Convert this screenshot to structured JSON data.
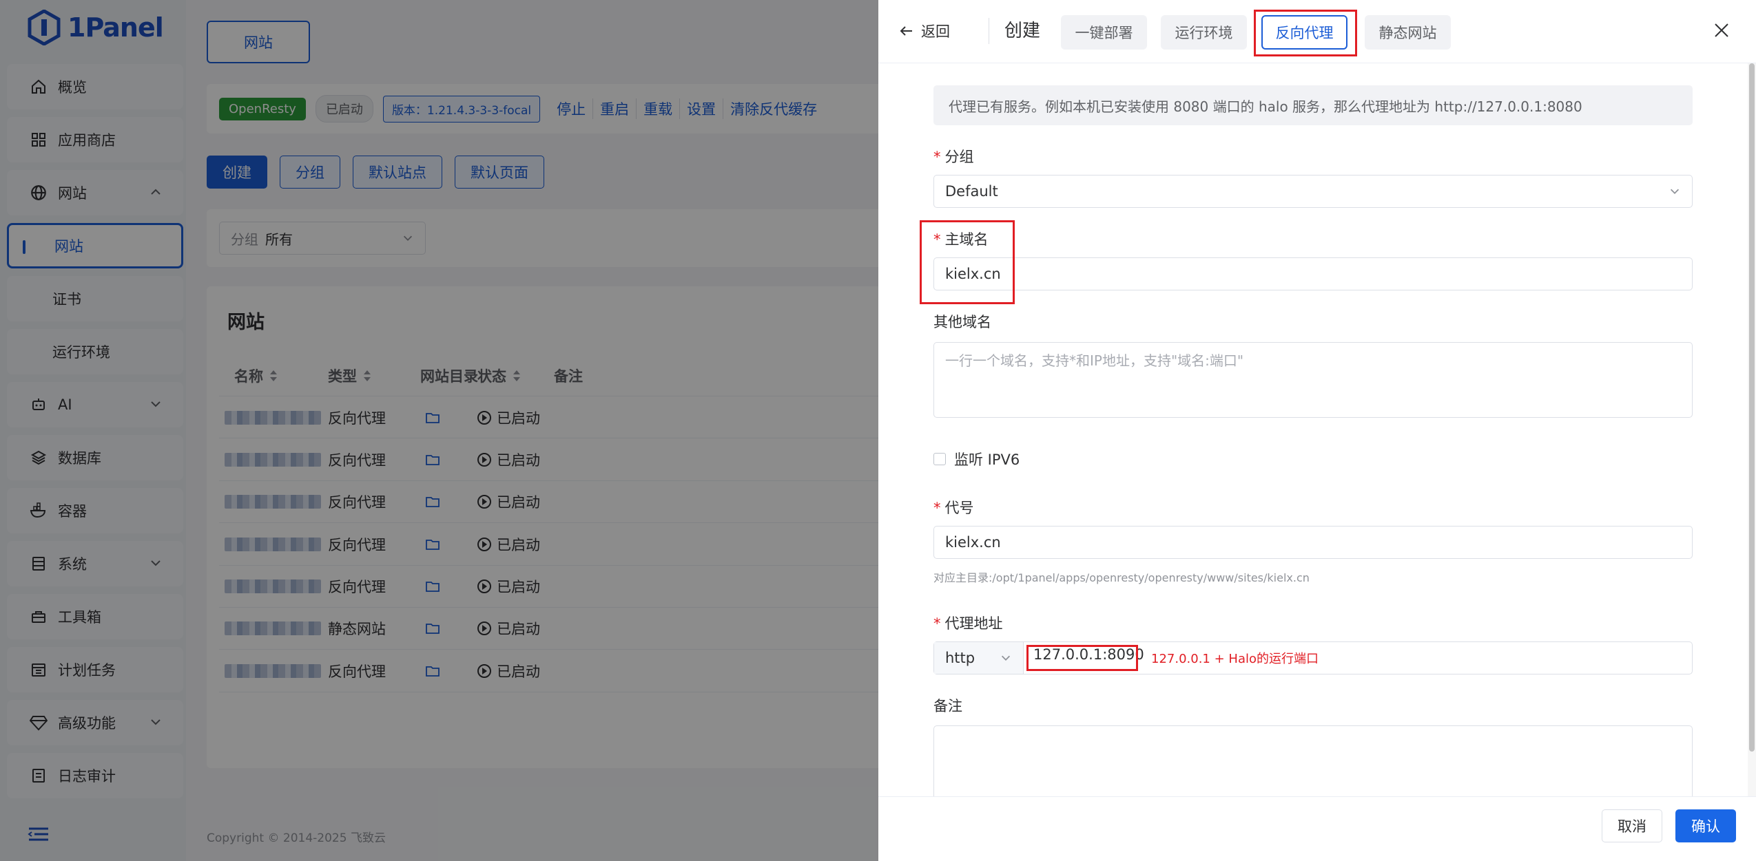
{
  "sidebar": {
    "logo_text": "1Panel",
    "items": [
      {
        "label": "概览",
        "icon": "home-icon"
      },
      {
        "label": "应用商店",
        "icon": "grid-icon"
      },
      {
        "label": "网站",
        "icon": "globe-icon"
      },
      {
        "label": "网站",
        "sub": true,
        "active": true
      },
      {
        "label": "证书",
        "sub": true
      },
      {
        "label": "运行环境",
        "sub": true
      },
      {
        "label": "AI",
        "icon": "robot-icon"
      },
      {
        "label": "数据库",
        "icon": "layers-icon"
      },
      {
        "label": "容器",
        "icon": "container-icon"
      },
      {
        "label": "系统",
        "icon": "server-icon"
      },
      {
        "label": "工具箱",
        "icon": "toolbox-icon"
      },
      {
        "label": "计划任务",
        "icon": "calendar-icon"
      },
      {
        "label": "高级功能",
        "icon": "diamond-icon"
      },
      {
        "label": "日志审计",
        "icon": "log-icon"
      }
    ]
  },
  "main": {
    "tab_label": "网站",
    "status": {
      "app": "OpenResty",
      "state": "已启动",
      "version": "版本：1.21.4.3-3-3-focal",
      "actions": [
        "停止",
        "重启",
        "重载",
        "设置",
        "清除反代缓存"
      ]
    },
    "buttons": {
      "create": "创建",
      "group": "分组",
      "default_site": "默认站点",
      "default_page": "默认页面"
    },
    "filter": {
      "label": "分组",
      "value": "所有"
    },
    "table": {
      "title": "网站",
      "columns": [
        "名称",
        "类型",
        "网站目录",
        "状态",
        "备注"
      ],
      "rows": [
        {
          "type": "反向代理",
          "status": "已启动"
        },
        {
          "type": "反向代理",
          "status": "已启动"
        },
        {
          "type": "反向代理",
          "status": "已启动"
        },
        {
          "type": "反向代理",
          "status": "已启动"
        },
        {
          "type": "反向代理",
          "status": "已启动"
        },
        {
          "type": "静态网站",
          "status": "已启动"
        },
        {
          "type": "反向代理",
          "status": "已启动"
        }
      ]
    },
    "footer": "Copyright © 2014-2025 飞致云"
  },
  "drawer": {
    "back_label": "返回",
    "title": "创建",
    "tabs": [
      "一键部署",
      "运行环境",
      "反向代理",
      "静态网站"
    ],
    "active_tab": "反向代理",
    "alert": "代理已有服务。例如本机已安装使用 8080 端口的 halo 服务，那么代理地址为 http://127.0.0.1:8080",
    "form": {
      "group_label": "分组",
      "group_value": "Default",
      "domain_label": "主域名",
      "domain_value": "kielx.cn",
      "other_domains_label": "其他域名",
      "other_domains_placeholder": "一行一个域名，支持*和IP地址，支持\"域名:端口\"",
      "ipv6_label": "监听 IPV6",
      "alias_label": "代号",
      "alias_value": "kielx.cn",
      "alias_hint": "对应主目录:/opt/1panel/apps/openresty/openresty/www/sites/kielx.cn",
      "proxy_label": "代理地址",
      "proxy_protocol": "http",
      "proxy_address": "127.0.0.1:8090",
      "proxy_annotation": "127.0.0.1 + Halo的运行端口",
      "remark_label": "备注"
    },
    "cancel_label": "取消",
    "confirm_label": "确认"
  },
  "colors": {
    "primary": "#1c5dd6",
    "highlight": "#e11e24",
    "success": "#2d9b3b"
  }
}
